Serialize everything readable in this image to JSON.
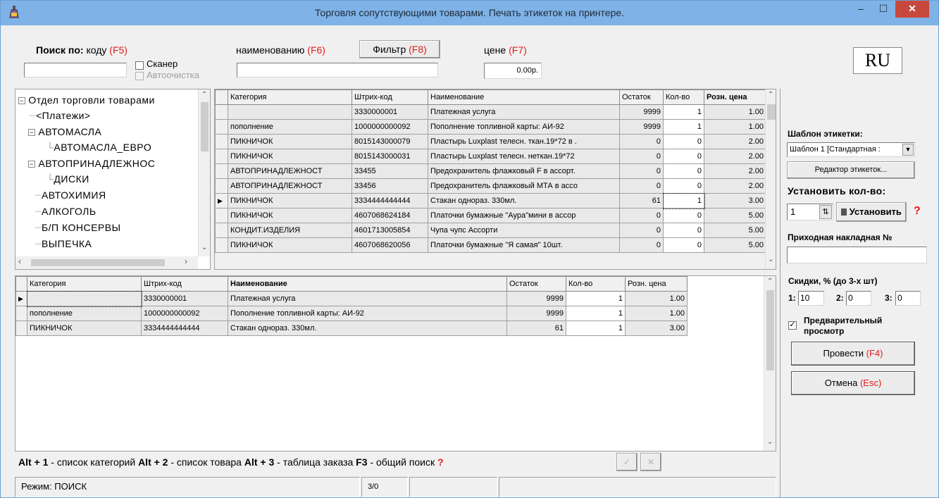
{
  "window": {
    "title": "Торговля сопутствующими товарами. Печать этикеток на принтере.",
    "min_glyph": "–",
    "max_glyph": "☐",
    "close_glyph": "✕"
  },
  "search": {
    "label_bold": "Поиск по:",
    "code_label": "коду",
    "code_key": "(F5)",
    "scanner_label": "Сканер",
    "autoclean_label": "Автоочистка",
    "name_label": "наименованию",
    "name_key": "(F6)",
    "filter_label": "Фильтр",
    "filter_key": "(F8)",
    "price_label": "цене",
    "price_key": "(F7)",
    "price_value": "0.00р.",
    "lang": "RU"
  },
  "tree": {
    "root": "Отдел торговли товарами",
    "items": [
      "<Платежи>",
      "АВТОМАСЛА",
      "АВТОМАСЛА_ЕВРО",
      "АВТОПРИНАДЛЕЖНОС",
      "ДИСКИ",
      "АВТОХИМИЯ",
      "АЛКОГОЛЬ",
      "Б/П КОНСЕРВЫ",
      "ВЫПЕЧКА"
    ]
  },
  "products": {
    "headers": [
      "Категория",
      "Штрих-код",
      "Наименование",
      "Остаток",
      "Кол-во",
      "Розн. цена"
    ],
    "rows": [
      [
        "",
        "3330000001",
        "Платежная услуга",
        "9999",
        "1",
        "1.00"
      ],
      [
        "пополнение",
        "1000000000092",
        "Пополнение топливной карты: АИ-92",
        "9999",
        "1",
        "1.00"
      ],
      [
        "ПИКНИЧОК",
        "8015143000079",
        "Пластырь Luxplast телесн. ткан.19*72 в .",
        "0",
        "0",
        "2.00"
      ],
      [
        "ПИКНИЧОК",
        "8015143000031",
        "Пластырь Luxplast телесн. неткан.19*72",
        "0",
        "0",
        "2.00"
      ],
      [
        "АВТОПРИНАДЛЕЖНОСТ",
        "33455",
        "Предохранитель флажковый F в ассорт.",
        "0",
        "0",
        "2.00"
      ],
      [
        "АВТОПРИНАДЛЕЖНОСТ",
        "33456",
        "Предохранитель флажковый МТА в ассо",
        "0",
        "0",
        "2.00"
      ],
      [
        "ПИКНИЧОК",
        "3334444444444",
        "Стакан однораз. 330мл.",
        "61",
        "1",
        "3.00"
      ],
      [
        "ПИКНИЧОК",
        "4607068624184",
        "Платочки бумажные \"Аура\"мини в ассор",
        "0",
        "0",
        "5.00"
      ],
      [
        "КОНДИТ.ИЗДЕЛИЯ",
        "4601713005854",
        "Чупа чупс Ассорти",
        "0",
        "0",
        "5.00"
      ],
      [
        "ПИКНИЧОК",
        "4607068620056",
        "Платочки бумажные \"Я самая\" 10шт.",
        "0",
        "0",
        "5.00"
      ]
    ]
  },
  "order": {
    "headers": [
      "Категория",
      "Штрих-код",
      "Наименование",
      "Остаток",
      "Кол-во",
      "Розн. цена"
    ],
    "rows": [
      [
        "",
        "3330000001",
        "Платежная услуга",
        "9999",
        "1",
        "1.00"
      ],
      [
        "пополнение",
        "1000000000092",
        "Пополнение топливной карты: АИ-92",
        "9999",
        "1",
        "1.00"
      ],
      [
        "ПИКНИЧОК",
        "3334444444444",
        "Стакан однораз. 330мл.",
        "61",
        "1",
        "3.00"
      ]
    ]
  },
  "right": {
    "template_label": "Шаблон этикетки:",
    "template_value": "Шаблон 1 [Стандартная :",
    "editor_button": "Редактор этикеток...",
    "setqty_label": "Установить кол-во:",
    "qty_value": "1",
    "set_button": "Установить",
    "help": "?",
    "invoice_label": "Приходная накладная №",
    "invoice_value": "",
    "discounts_label": "Скидки, % (до 3-х шт)",
    "d1_label": "1:",
    "d1": "10",
    "d2_label": "2:",
    "d2": "0",
    "d3_label": "3:",
    "d3": "0",
    "preview_line1": "Предварительный",
    "preview_line2": "просмотр",
    "post_button": "Провести",
    "post_key": "(F4)",
    "cancel_button": "Отмена",
    "cancel_key": "(Esc)"
  },
  "hotkeys": {
    "k1": "Alt + 1",
    "t1": " - список категорий",
    "k2": "Alt + 2",
    "t2": " - список товара",
    "k3": "Alt + 3",
    "t3": " - таблица заказа",
    "k4": "F3",
    "t4": " - общий поиск",
    "help": "?"
  },
  "status": {
    "mode": "Режим: ПОИСК",
    "count": "3/0"
  }
}
